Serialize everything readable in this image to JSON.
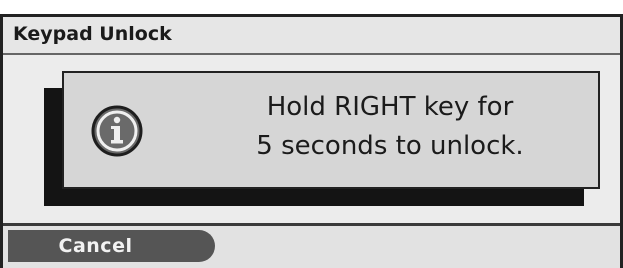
{
  "window": {
    "title": "Keypad Unlock"
  },
  "dialog": {
    "icon": "info-icon",
    "message_line_1": "Hold RIGHT key for",
    "message_line_2": "5 seconds to unlock."
  },
  "softkeys": {
    "cancel_label": "Cancel"
  },
  "colors": {
    "background": "#e9e9e9",
    "dialog_fill": "#d6d6d6",
    "dialog_shadow": "#141414",
    "button_fill": "#555555",
    "text": "#1b1b1b"
  }
}
